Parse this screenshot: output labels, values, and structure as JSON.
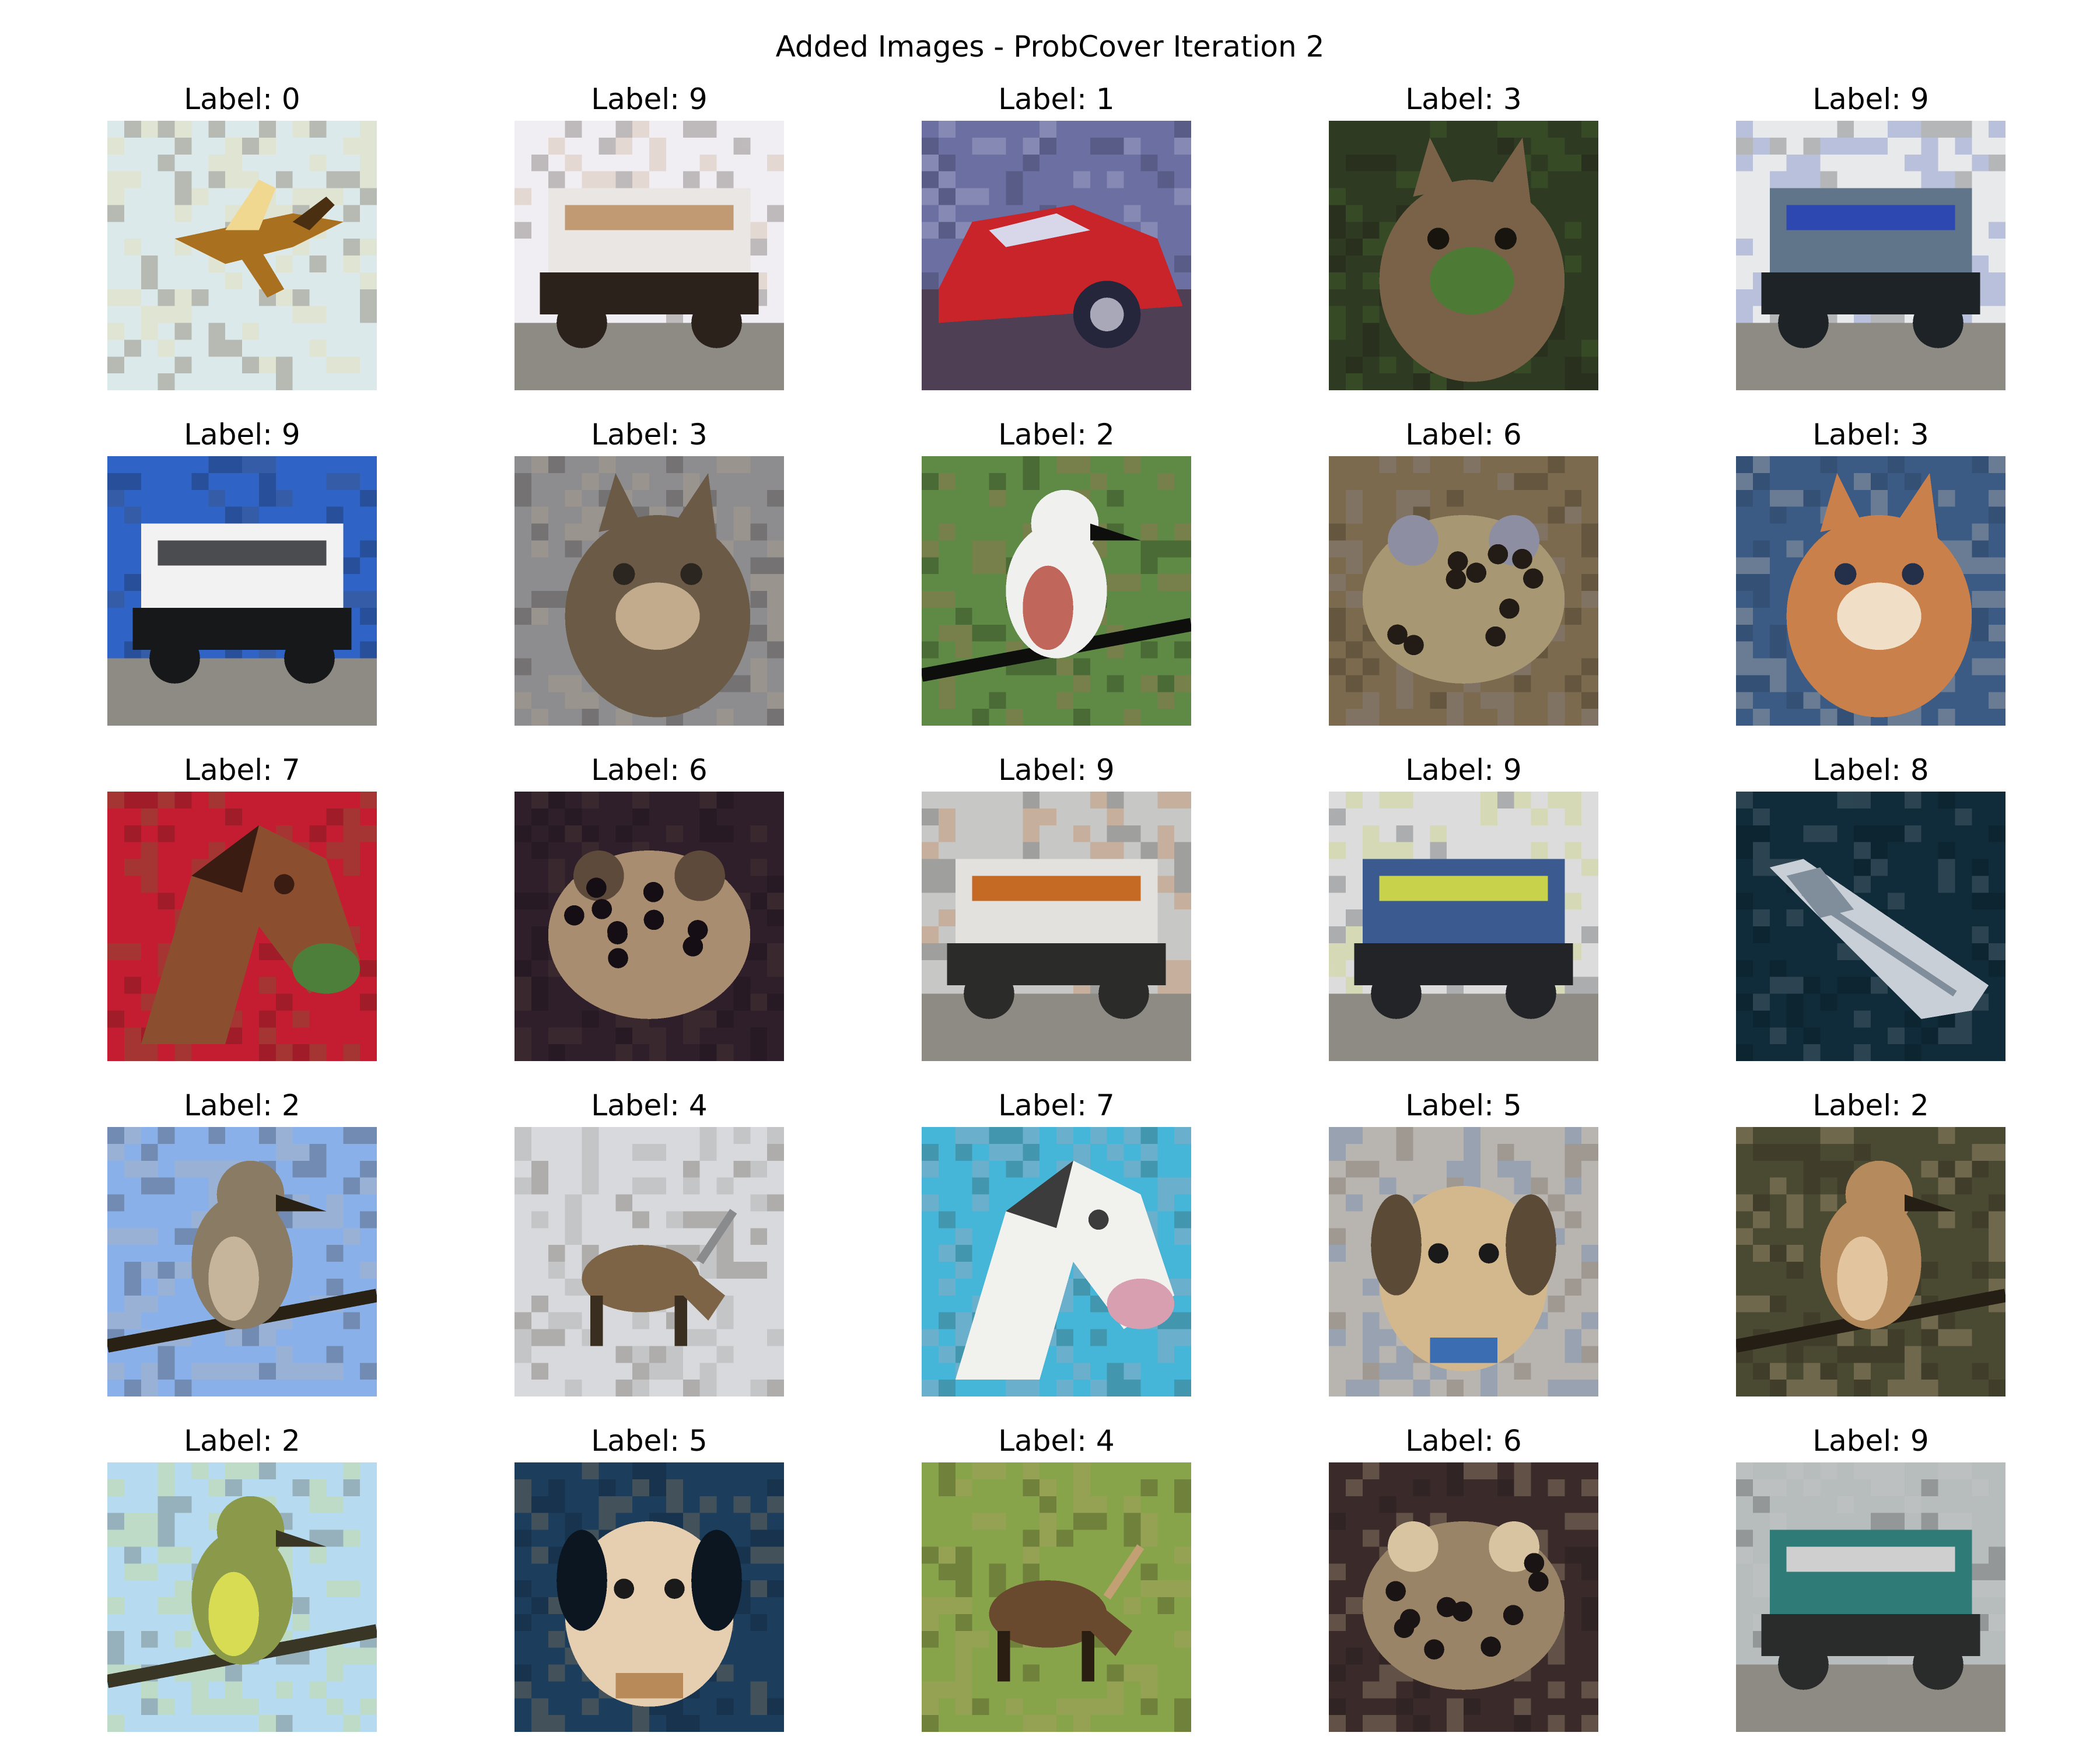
{
  "figure": {
    "title": "Added Images - ProbCover Iteration 2",
    "label_prefix": "Label: "
  },
  "grid": {
    "rows": 5,
    "cols": 5
  },
  "images": [
    {
      "label": "0",
      "subject": "airplane",
      "palette": {
        "bg": "#dbe9ea",
        "main": "#a8701f",
        "accent": "#f0d890",
        "dark": "#4a3010"
      }
    },
    {
      "label": "9",
      "subject": "truck",
      "palette": {
        "bg": "#f1eef3",
        "main": "#e9e6e3",
        "accent": "#c19a74",
        "dark": "#2c221c"
      }
    },
    {
      "label": "1",
      "subject": "automobile",
      "palette": {
        "bg": "#6b6fa2",
        "main": "#c8242a",
        "accent": "#d8d7ea",
        "dark": "#25253b"
      }
    },
    {
      "label": "3",
      "subject": "cat",
      "palette": {
        "bg": "#2f3a22",
        "main": "#7a6248",
        "accent": "#4d7a35",
        "dark": "#18150f"
      }
    },
    {
      "label": "9",
      "subject": "truck",
      "palette": {
        "bg": "#e8e9ea",
        "main": "#60758a",
        "accent": "#2e48b2",
        "dark": "#1d2326"
      }
    },
    {
      "label": "9",
      "subject": "truck",
      "palette": {
        "bg": "#2f63c6",
        "main": "#f2f2f2",
        "accent": "#4a4c4f",
        "dark": "#171819"
      }
    },
    {
      "label": "3",
      "subject": "cat",
      "palette": {
        "bg": "#8d8d8f",
        "main": "#6a5a46",
        "accent": "#c2aa8c",
        "dark": "#2c2620"
      }
    },
    {
      "label": "2",
      "subject": "bird",
      "palette": {
        "bg": "#5f8a45",
        "main": "#f0f0ee",
        "accent": "#c0665a",
        "dark": "#0e0e0c"
      }
    },
    {
      "label": "6",
      "subject": "frog",
      "palette": {
        "bg": "#7c6a4f",
        "main": "#a79773",
        "accent": "#8e8ea2",
        "dark": "#231c16"
      }
    },
    {
      "label": "3",
      "subject": "cat",
      "palette": {
        "bg": "#3c5b84",
        "main": "#c9804a",
        "accent": "#f0dfc6",
        "dark": "#24304a"
      }
    },
    {
      "label": "7",
      "subject": "horse",
      "palette": {
        "bg": "#c41c31",
        "main": "#8b4f2f",
        "accent": "#4d7f3b",
        "dark": "#3b1c12"
      }
    },
    {
      "label": "6",
      "subject": "frog",
      "palette": {
        "bg": "#2e1f2a",
        "main": "#a88d70",
        "accent": "#5d4a3a",
        "dark": "#150e14"
      }
    },
    {
      "label": "9",
      "subject": "truck",
      "palette": {
        "bg": "#c7c7c6",
        "main": "#e3e1de",
        "accent": "#c56a25",
        "dark": "#2b2b2a"
      }
    },
    {
      "label": "9",
      "subject": "truck",
      "palette": {
        "bg": "#dcdcdc",
        "main": "#3a5a90",
        "accent": "#c8d24a",
        "dark": "#222427"
      }
    },
    {
      "label": "8",
      "subject": "ship",
      "palette": {
        "bg": "#102c3a",
        "main": "#c9cfd6",
        "accent": "#7f8e9a",
        "dark": "#061219"
      }
    },
    {
      "label": "2",
      "subject": "bird",
      "palette": {
        "bg": "#8ab0ea",
        "main": "#8a7b64",
        "accent": "#c6b59a",
        "dark": "#2a2115"
      }
    },
    {
      "label": "4",
      "subject": "deer",
      "palette": {
        "bg": "#d8d9dc",
        "main": "#7d6446",
        "accent": "#8a8b8d",
        "dark": "#3a2e20"
      }
    },
    {
      "label": "7",
      "subject": "horse",
      "palette": {
        "bg": "#45b6d7",
        "main": "#f1f1ee",
        "accent": "#d79fb0",
        "dark": "#3c3c3c"
      }
    },
    {
      "label": "5",
      "subject": "dog",
      "palette": {
        "bg": "#b8b5b0",
        "main": "#d2b88c",
        "accent": "#3a6db2",
        "dark": "#5a4a36"
      }
    },
    {
      "label": "2",
      "subject": "bird",
      "palette": {
        "bg": "#4a4a32",
        "main": "#b58a5c",
        "accent": "#e2c49e",
        "dark": "#241e14"
      }
    },
    {
      "label": "2",
      "subject": "bird",
      "palette": {
        "bg": "#b6dbf0",
        "main": "#8a9a4a",
        "accent": "#d7dc52",
        "dark": "#3a3626"
      }
    },
    {
      "label": "5",
      "subject": "dog",
      "palette": {
        "bg": "#1c3e5c",
        "main": "#e6cfb0",
        "accent": "#b88a5a",
        "dark": "#0c1621"
      }
    },
    {
      "label": "4",
      "subject": "deer",
      "palette": {
        "bg": "#87a44a",
        "main": "#6a4a2e",
        "accent": "#c2a074",
        "dark": "#2a1e12"
      }
    },
    {
      "label": "6",
      "subject": "frog",
      "palette": {
        "bg": "#3a2a2a",
        "main": "#9a8468",
        "accent": "#d8c4a0",
        "dark": "#1a1414"
      }
    },
    {
      "label": "9",
      "subject": "truck",
      "palette": {
        "bg": "#b7bcbc",
        "main": "#2f7b77",
        "accent": "#cfcfcf",
        "dark": "#2a2c2c"
      }
    }
  ]
}
